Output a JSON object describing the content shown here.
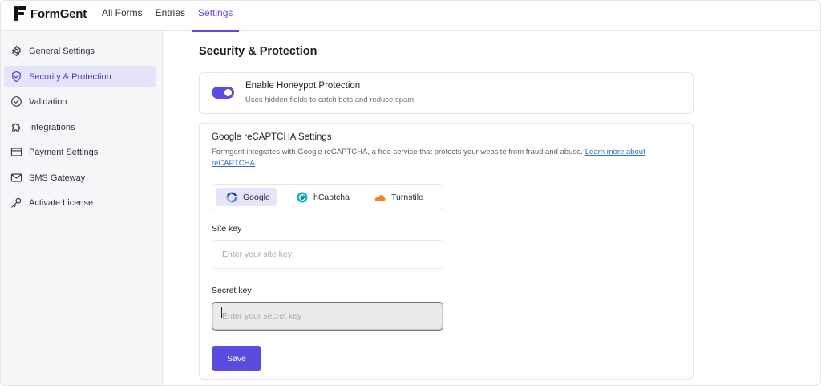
{
  "app": {
    "name": "FormGent"
  },
  "topnav": {
    "tabs": [
      {
        "label": "All Forms",
        "active": false
      },
      {
        "label": "Entries",
        "active": false
      },
      {
        "label": "Settings",
        "active": true
      }
    ]
  },
  "sidebar": {
    "items": [
      {
        "label": "General Settings",
        "icon": "gear-icon"
      },
      {
        "label": "Security & Protection",
        "icon": "shield-icon",
        "active": true
      },
      {
        "label": "Validation",
        "icon": "check-circle-icon"
      },
      {
        "label": "Integrations",
        "icon": "puzzle-icon"
      },
      {
        "label": "Payment Settings",
        "icon": "credit-card-icon"
      },
      {
        "label": "SMS Gateway",
        "icon": "envelope-icon"
      },
      {
        "label": "Activate License",
        "icon": "key-icon"
      }
    ]
  },
  "main": {
    "title": "Security & Protection",
    "honeypot": {
      "title": "Enable Honeypot Protection",
      "description": "Uses hidden fields to catch bots and reduce spam",
      "enabled": true
    },
    "recaptcha": {
      "title": "Google reCAPTCHA Settings",
      "description": "Formgent integrates with Google reCAPTCHA, a free service that protects your website from fraud and abuse.",
      "link_text": "Learn more about reCAPTCHA",
      "providers": [
        {
          "label": "Google",
          "icon": "recaptcha-icon",
          "active": true
        },
        {
          "label": "hCaptcha",
          "icon": "hcaptcha-icon",
          "active": false
        },
        {
          "label": "Turnstile",
          "icon": "cloudflare-icon",
          "active": false
        }
      ],
      "site_key": {
        "label": "Site key",
        "placeholder": "Enter your site key",
        "value": ""
      },
      "secret_key": {
        "label": "Secret key",
        "placeholder": "Enter your secret key",
        "value": ""
      },
      "save_label": "Save"
    }
  },
  "colors": {
    "accent": "#5b4ce0",
    "active_bg": "#e6e4fb",
    "link": "#2f6fc4"
  }
}
